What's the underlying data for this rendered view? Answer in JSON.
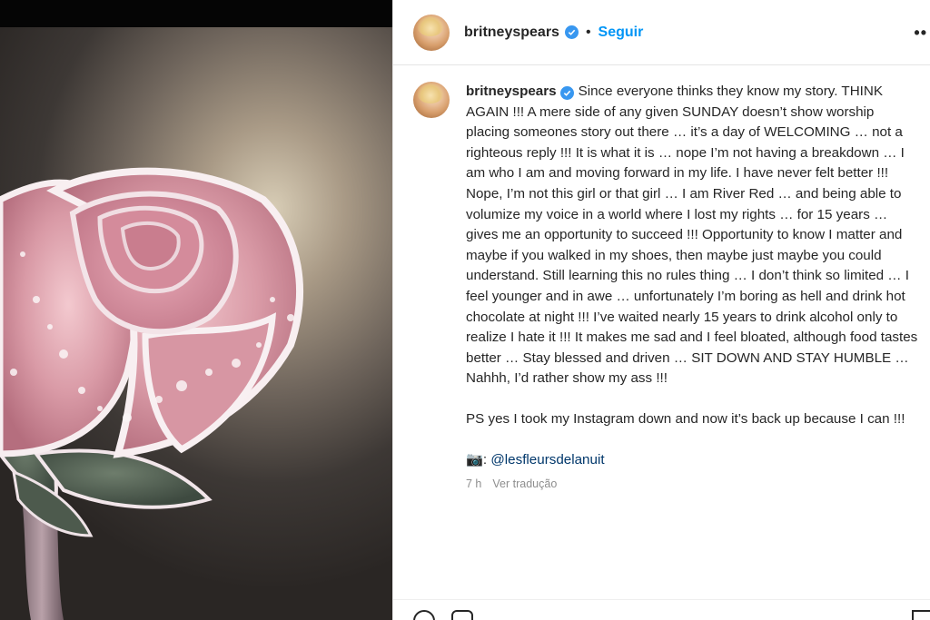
{
  "post": {
    "username": "britneyspears",
    "separator": "•",
    "follow_label": "Seguir",
    "more_icon": "more-options-icon",
    "caption": "Since everyone thinks they know my story. THINK AGAIN !!! A mere side of any given SUNDAY doesn’t show worship placing someones story out there … it’s a day of WELCOMING … not a righteous reply !!! It is what it is … nope I’m not having a breakdown … I am who I am and moving forward in my life. I have never felt better !!! Nope, I’m not this girl or that girl … I am River Red … and being able to volumize my voice in a world where I lost my rights … for 15 years … gives me an opportunity to succeed !!! Opportunity to know I matter and maybe if you walked in my shoes, then maybe just maybe you could understand. Still learning this no rules thing … I don’t think so limited … I feel younger and in awe … unfortunately I’m boring as hell and drink hot chocolate at night !!! I’ve waited nearly 15 years to drink alcohol only to realize I hate it !!! It makes me sad and I feel bloated, although food tastes better … Stay blessed and driven … SIT DOWN AND STAY HUMBLE … Nahhh, I’d rather show my ass !!!",
    "ps": "PS yes I took my Instagram down and now it’s back up because I can !!!",
    "credit_emoji": "📷:",
    "credit_mention": "@lesfleursdelanuit",
    "time_ago": "7 h",
    "translate_label": "Ver tradução"
  },
  "colors": {
    "follow": "#0095f6",
    "verified": "#3897f0",
    "mention": "#00376b",
    "meta": "#8e8e8e"
  }
}
